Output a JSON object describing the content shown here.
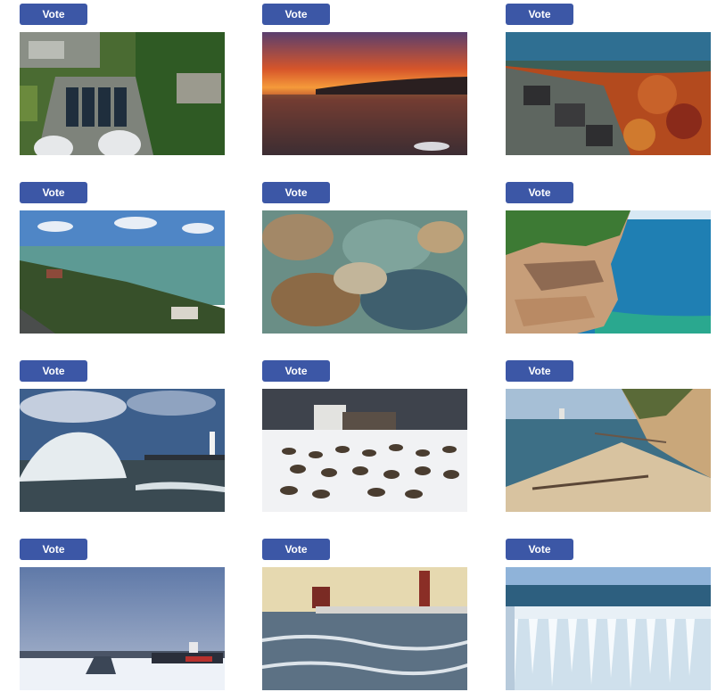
{
  "gallery": {
    "vote_label": "Vote",
    "cards": [
      {
        "photo": "aerial-water-treatment-plant-photo"
      },
      {
        "photo": "sunset-over-lake-photo"
      },
      {
        "photo": "aerial-autumn-shoreline-photo"
      },
      {
        "photo": "aerial-lakeshore-town-photo"
      },
      {
        "photo": "underwater-rocks-photo"
      },
      {
        "photo": "cliff-turquoise-water-photo"
      },
      {
        "photo": "crashing-wave-lighthouse-photo"
      },
      {
        "photo": "ducks-on-snow-photo"
      },
      {
        "photo": "beach-driftwood-dunes-photo"
      },
      {
        "photo": "ice-fishing-shanty-photo"
      },
      {
        "photo": "lighthouse-pier-winter-photo"
      },
      {
        "photo": "ice-covered-railing-photo"
      }
    ]
  }
}
